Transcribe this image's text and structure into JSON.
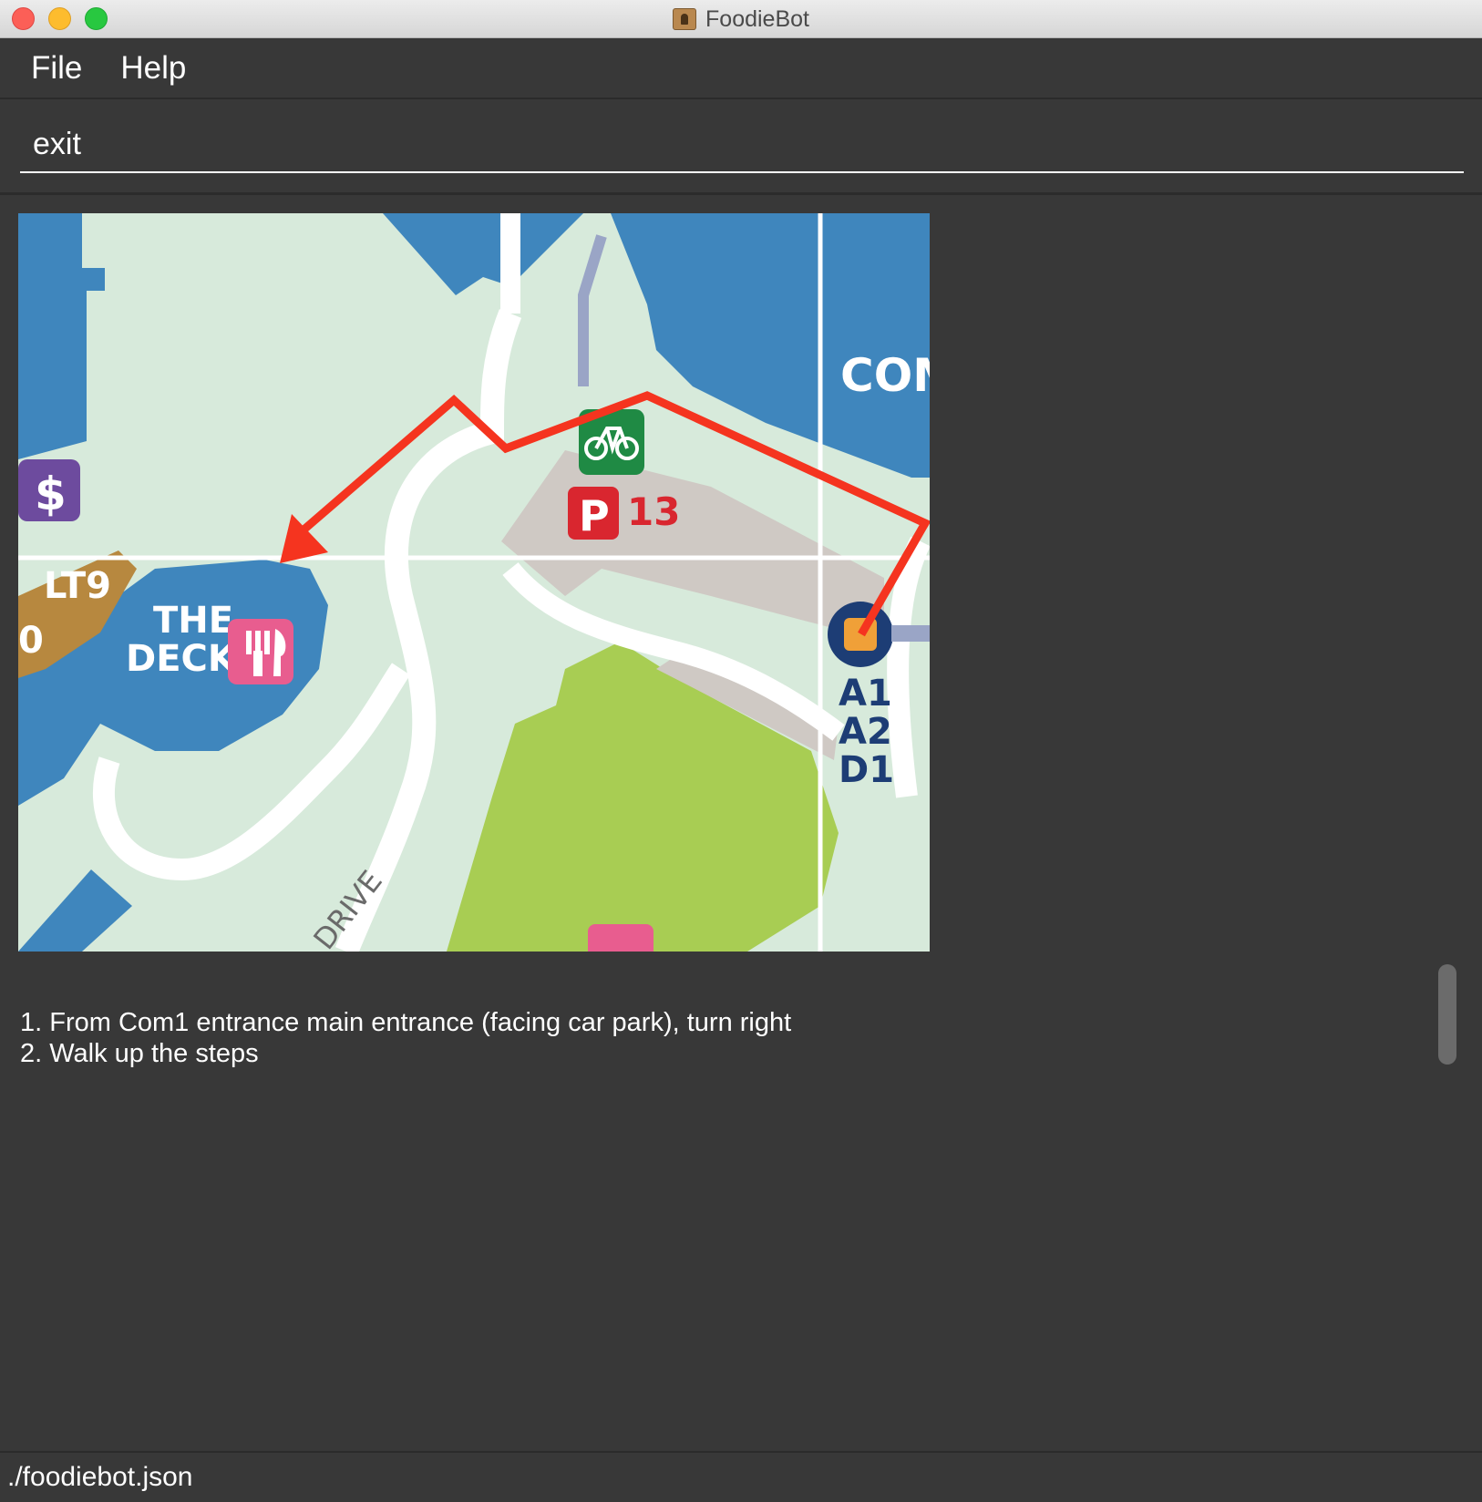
{
  "window": {
    "title": "FoodieBot"
  },
  "menu": {
    "items": [
      {
        "label": "File"
      },
      {
        "label": "Help"
      }
    ]
  },
  "command": {
    "value": "exit"
  },
  "map": {
    "labels": {
      "com": "COM",
      "the": "THE",
      "deck": "DECK",
      "lt9": "LT9",
      "parking_letter": "P",
      "parking_number": "13",
      "dollar": "$",
      "bus_routes": [
        "A1",
        "A2",
        "D1"
      ],
      "road": "DRIVE",
      "zero": "0"
    },
    "colors": {
      "route": "#f5341f",
      "building": "#3f86bd",
      "ground": "#d7eadb",
      "green": "#a8cd53",
      "parking": "#d9262f",
      "bike": "#1f8a44",
      "food": "#e85d8f",
      "lecture": "#b7883f",
      "atm": "#6d4b9e"
    }
  },
  "directions": {
    "steps": [
      "1. From Com1 entrance main entrance (facing car park), turn right",
      "2. Walk up the steps"
    ]
  },
  "status": {
    "file_path": "./foodiebot.json"
  }
}
